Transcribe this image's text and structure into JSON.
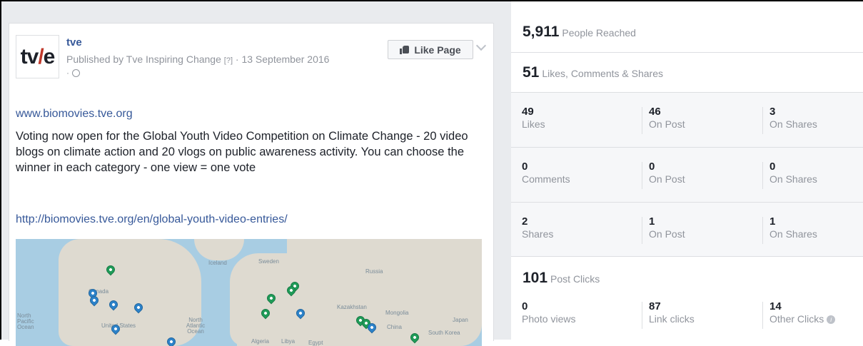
{
  "post": {
    "logo_text": "tv/e",
    "page_name": "tve",
    "published_by": "Published by Tve Inspiring Change",
    "help_mark": "[?]",
    "date": "· 13 September 2016",
    "audience_sep": "·",
    "like_page_label": "Like Page",
    "site_link": "www.biomovies.tve.org",
    "body": "Voting now open for the Global Youth Video Competition on Climate Change - 20 video blogs on climate action and 20 vlogs on public awareness activity. You can choose the winner in each category - one view = one vote",
    "entries_link": "http://biomovies.tve.org/en/global-youth-video-entries/",
    "map_labels": {
      "north_pacific": "North Pacific Ocean",
      "north_atlantic": "North Atlantic Ocean",
      "canada": "Canada",
      "united_states": "United States",
      "russia": "Russia",
      "kazakhstan": "Kazakhstan",
      "mongolia": "Mongolia",
      "china": "China",
      "japan": "Japan",
      "sweden": "Sweden",
      "iceland": "Iceland",
      "algeria": "Algeria",
      "libya": "Libya",
      "egypt": "Egypt",
      "south_korea": "South Korea"
    }
  },
  "insights": {
    "reached": {
      "value": "5,911",
      "label": "People Reached"
    },
    "engagement": {
      "value": "51",
      "label": "Likes, Comments & Shares"
    },
    "rows": [
      [
        {
          "value": "49",
          "label": "Likes"
        },
        {
          "value": "46",
          "label": "On Post"
        },
        {
          "value": "3",
          "label": "On Shares"
        }
      ],
      [
        {
          "value": "0",
          "label": "Comments"
        },
        {
          "value": "0",
          "label": "On Post"
        },
        {
          "value": "0",
          "label": "On Shares"
        }
      ],
      [
        {
          "value": "2",
          "label": "Shares"
        },
        {
          "value": "1",
          "label": "On Post"
        },
        {
          "value": "1",
          "label": "On Shares"
        }
      ]
    ],
    "clicks": {
      "value": "101",
      "label": "Post Clicks"
    },
    "click_row": [
      {
        "value": "0",
        "label": "Photo views"
      },
      {
        "value": "87",
        "label": "Link clicks"
      },
      {
        "value": "14",
        "label": "Other Clicks"
      }
    ]
  },
  "colors": {
    "link": "#365899",
    "muted": "#90949c",
    "pin_green": "#1f9b58",
    "pin_blue": "#2c82c9"
  }
}
